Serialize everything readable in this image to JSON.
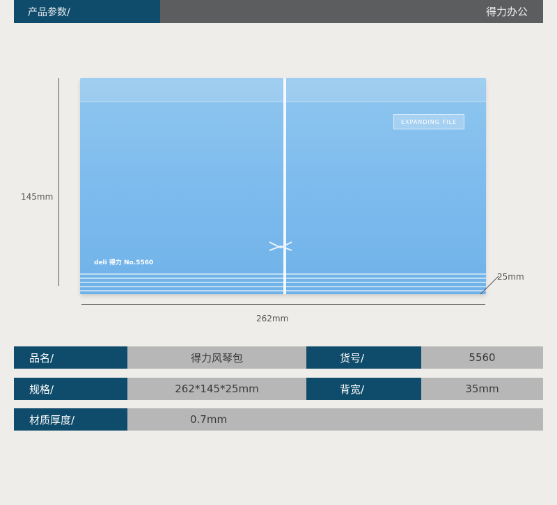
{
  "header": {
    "section_title": "产品参数/",
    "brand_name": "得力办公"
  },
  "product_image": {
    "label_text": "EXPANDING FILE",
    "brand_text": "deli 得力 No.5560",
    "colors": {
      "folder": "#7fbcee"
    }
  },
  "dimensions": {
    "height": "145mm",
    "width": "262mm",
    "depth": "25mm"
  },
  "specs": {
    "name_label": "品名/",
    "name_value": "得力风琴包",
    "item_no_label": "货号/",
    "item_no_value": "5560",
    "size_label": "规格/",
    "size_value": "262*145*25mm",
    "spine_label": "背宽/",
    "spine_value": "35mm",
    "thickness_label": "材质厚度/",
    "thickness_value": "0.7mm"
  },
  "colors": {
    "label_bg": "#0f4b6a",
    "value_bg": "#b7b7b7",
    "header_right_bg": "#5b5d5f",
    "page_bg": "#efedea"
  }
}
